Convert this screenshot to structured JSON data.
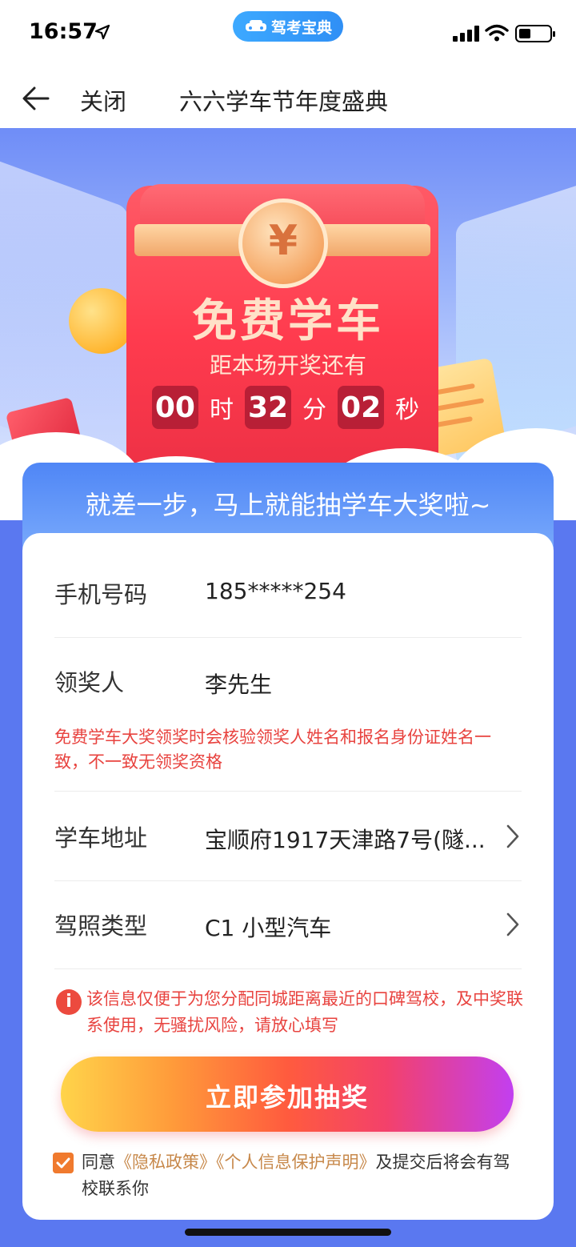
{
  "status_bar": {
    "time": "16:57",
    "app_badge": "驾考宝典"
  },
  "nav": {
    "close_label": "关闭",
    "title": "六六学车节年度盛典"
  },
  "hero": {
    "coin_symbol": "¥",
    "title": "免费学车",
    "subtitle": "距本场开奖还有",
    "countdown": {
      "hours": "00",
      "hours_unit": "时",
      "minutes": "32",
      "minutes_unit": "分",
      "seconds": "02",
      "seconds_unit": "秒"
    }
  },
  "banner": {
    "text": "就差一步，马上就能抽学车大奖啦~"
  },
  "form": {
    "phone": {
      "label": "手机号码",
      "value": "185*****254"
    },
    "winner": {
      "label": "领奖人",
      "value": "李先生"
    },
    "winner_warning": "免费学车大奖领奖时会核验领奖人姓名和报名身份证姓名一致，不一致无领奖资格",
    "address": {
      "label": "学车地址",
      "value": "宝顺府1917天津路7号(隧..."
    },
    "license": {
      "label": "驾照类型",
      "value": "C1 小型汽车"
    },
    "info_icon": "i",
    "info_text": "该信息仅便于为您分配同城距离最近的口碑驾校，及中奖联系使用，无骚扰风险，请放心填写",
    "submit_label": "立即参加抽奖",
    "agree": {
      "prefix": "同意",
      "privacy_link": "《隐私政策》",
      "personal_info_link": "《个人信息保护声明》",
      "suffix": "及提交后将会有驾校联系你",
      "checked": true
    }
  },
  "colors": {
    "page_bg": "#5a78f0",
    "accent_red": "#e8433f",
    "link_gold": "#c7884a",
    "checkbox": "#f07a2e"
  },
  "icons": [
    "location-arrow-icon",
    "car-icon",
    "signal-icon",
    "wifi-icon",
    "battery-icon",
    "back-arrow-icon",
    "chevron-right-icon",
    "info-icon",
    "checkbox-checked-icon"
  ]
}
